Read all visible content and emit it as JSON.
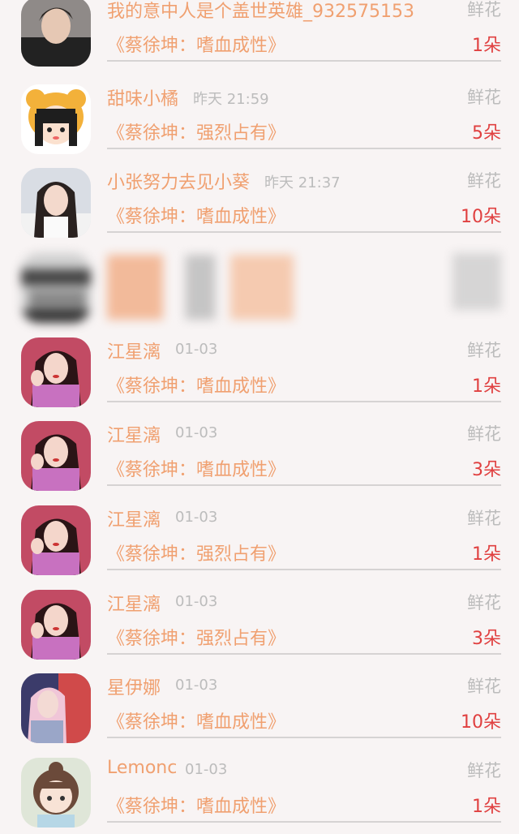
{
  "items": [
    {
      "name": "我的意中人是个盖世英雄_932575153",
      "time": "",
      "gift": "鲜花",
      "book": "《蔡徐坤：嗜血成性》",
      "count": "1朵",
      "avatar": "male-portrait"
    },
    {
      "name": "甜味小橘",
      "time": "昨天 21:59",
      "gift": "鲜花",
      "book": "《蔡徐坤：强烈占有》",
      "count": "5朵",
      "avatar": "cartoon-bear-girl"
    },
    {
      "name": "小张努力去见小葵",
      "time": "昨天 21:37",
      "gift": "鲜花",
      "book": "《蔡徐坤：嗜血成性》",
      "count": "10朵",
      "avatar": "girl-portrait"
    },
    {
      "name": "",
      "time": "",
      "gift": "",
      "book": "",
      "count": "",
      "avatar": "blurred",
      "blurred": true
    },
    {
      "name": "江星漓",
      "time": "01-03",
      "gift": "鲜花",
      "book": "《蔡徐坤：嗜血成性》",
      "count": "1朵",
      "avatar": "girl-pink-top"
    },
    {
      "name": "江星漓",
      "time": "01-03",
      "gift": "鲜花",
      "book": "《蔡徐坤：嗜血成性》",
      "count": "3朵",
      "avatar": "girl-pink-top"
    },
    {
      "name": "江星漓",
      "time": "01-03",
      "gift": "鲜花",
      "book": "《蔡徐坤：强烈占有》",
      "count": "1朵",
      "avatar": "girl-pink-top"
    },
    {
      "name": "江星漓",
      "time": "01-03",
      "gift": "鲜花",
      "book": "《蔡徐坤：强烈占有》",
      "count": "3朵",
      "avatar": "girl-pink-top"
    },
    {
      "name": "星伊娜",
      "time": "01-03",
      "gift": "鲜花",
      "book": "《蔡徐坤：嗜血成性》",
      "count": "10朵",
      "avatar": "girl-red-light"
    },
    {
      "name": "Lemonc",
      "time": "01-03",
      "gift": "鲜花",
      "book": "《蔡徐坤：嗜血成性》",
      "count": "1朵",
      "avatar": "cartoon-girl-bun"
    }
  ]
}
